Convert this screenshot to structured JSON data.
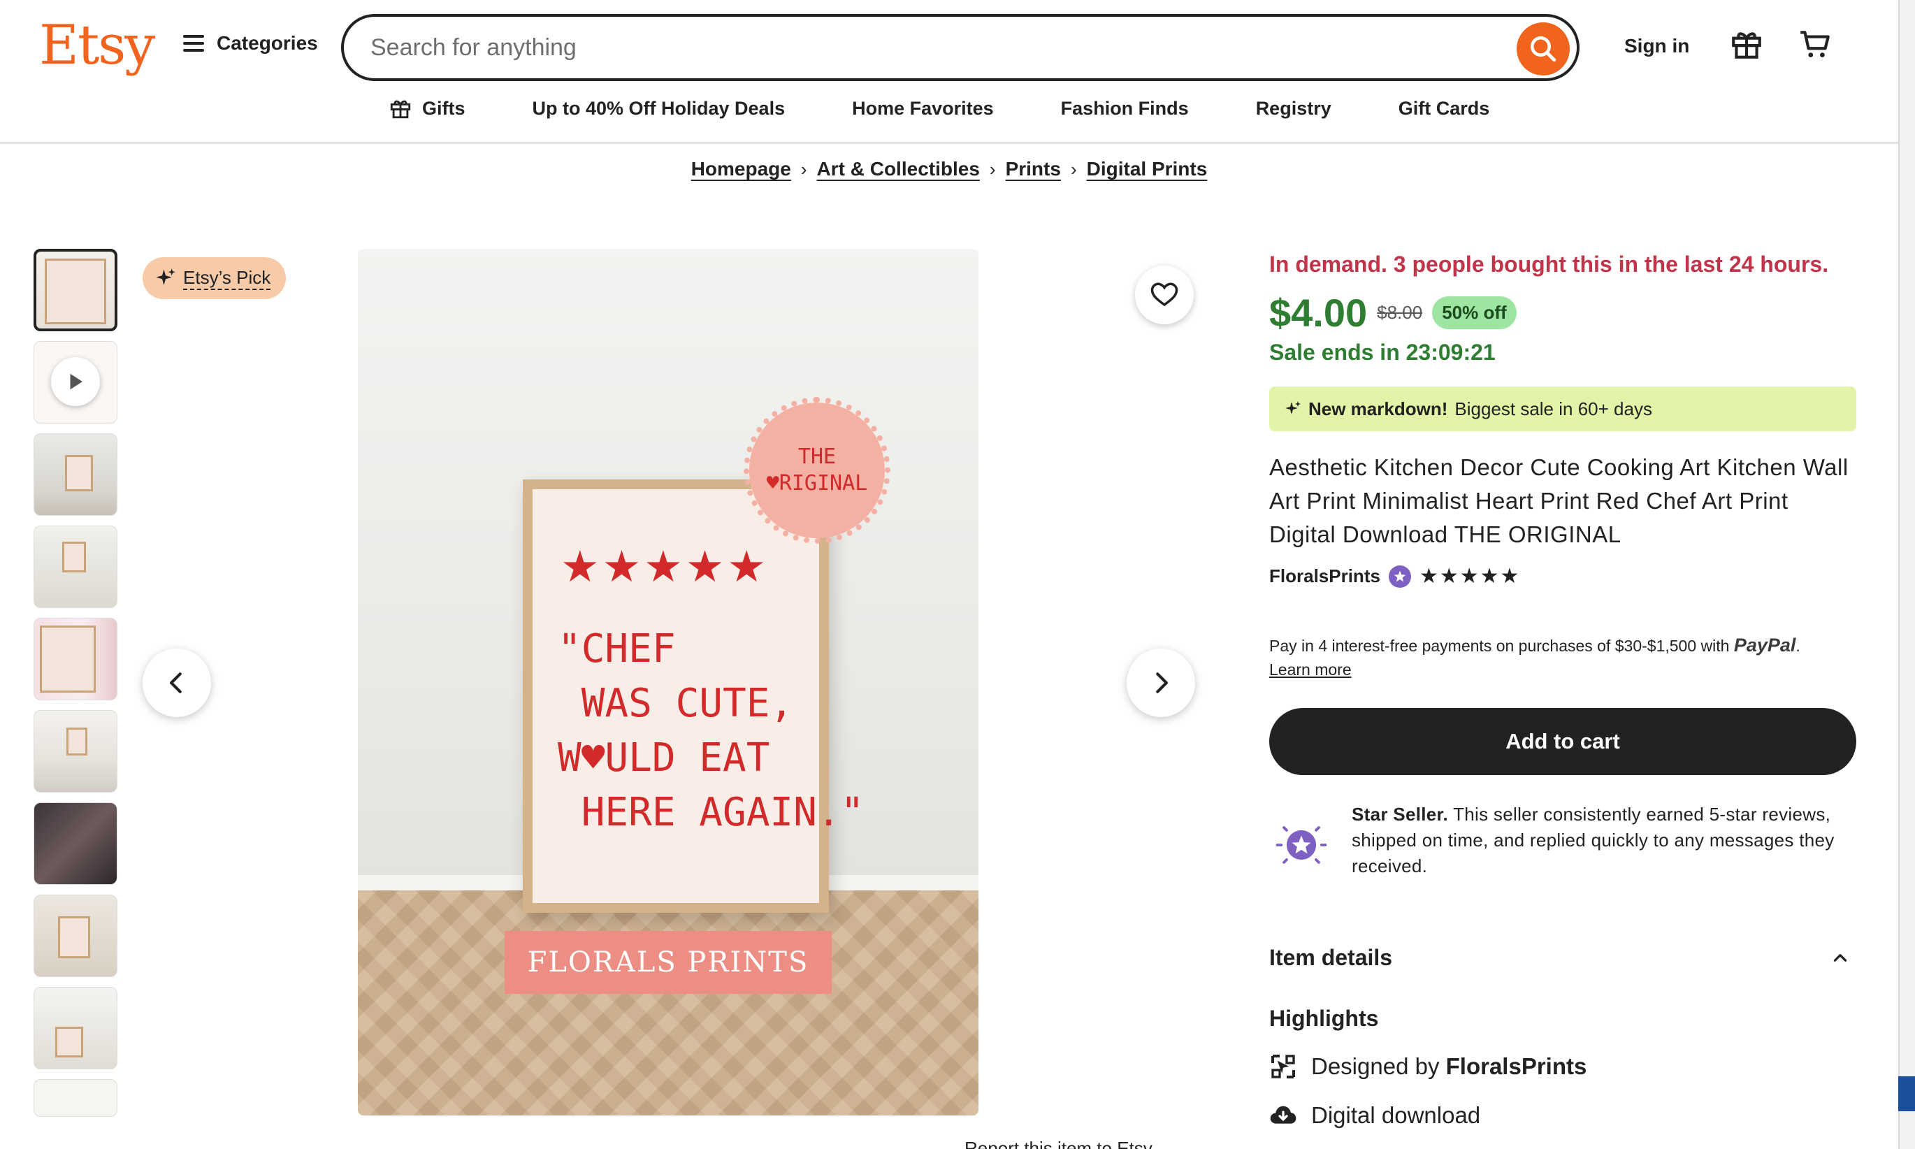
{
  "header": {
    "logo": "Etsy",
    "categories_label": "Categories",
    "search_placeholder": "Search for anything",
    "signin_label": "Sign in"
  },
  "subnav": [
    {
      "label": "Gifts",
      "icon": "gift-icon"
    },
    {
      "label": "Up to 40% Off Holiday Deals"
    },
    {
      "label": "Home Favorites"
    },
    {
      "label": "Fashion Finds"
    },
    {
      "label": "Registry"
    },
    {
      "label": "Gift Cards"
    }
  ],
  "breadcrumb": [
    "Homepage",
    "Art & Collectibles",
    "Prints",
    "Digital Prints"
  ],
  "gallery": {
    "pick_label": "Etsy’s Pick",
    "poster": {
      "stars": "★★★★★",
      "quote": "\"CHEF\n WAS CUTE,\nW♥ULD EAT\n HERE AGAIN.\"",
      "seal_line1": "THE",
      "seal_line2": "♥RIGINAL",
      "brand": "FLORALS PRINTS"
    },
    "report_label": "Report this item to Etsy"
  },
  "product": {
    "demand_text": "In demand. 3 people bought this in the last 24 hours.",
    "price": "$4.00",
    "original_price": "$8.00",
    "discount": "50% off",
    "sale_ends": "Sale ends in 23:09:21",
    "markdown_bold": "New markdown!",
    "markdown_text": "Biggest sale in 60+ days",
    "title": "Aesthetic Kitchen Decor Cute Cooking Art Kitchen Wall Art Print Minimalist Heart Print Red Chef Art Print Digital Download THE ORIGINAL",
    "seller": "FloralsPrints",
    "rating_stars": "★★★★★",
    "rating": 5,
    "paypal_text": "Pay in 4 interest-free payments on purchases of $30-$1,500 with",
    "paypal_brand": "PayPal",
    "learn_more": "Learn more",
    "add_to_cart": "Add to cart",
    "star_seller_bold": "Star Seller.",
    "star_seller_text": "This seller consistently earned 5-star reviews, shipped on time, and replied quickly to any messages they received.",
    "item_details": "Item details",
    "highlights": "Highlights",
    "designed_by": "Designed by",
    "designer": "FloralsPrints",
    "digital_download": "Digital download"
  },
  "colors": {
    "brand": "#f1641e",
    "sale_green": "#2f7d32",
    "demand_red": "#c2344a",
    "markdown_bg": "#e3f4a8",
    "poster_red": "#d22a2a"
  }
}
